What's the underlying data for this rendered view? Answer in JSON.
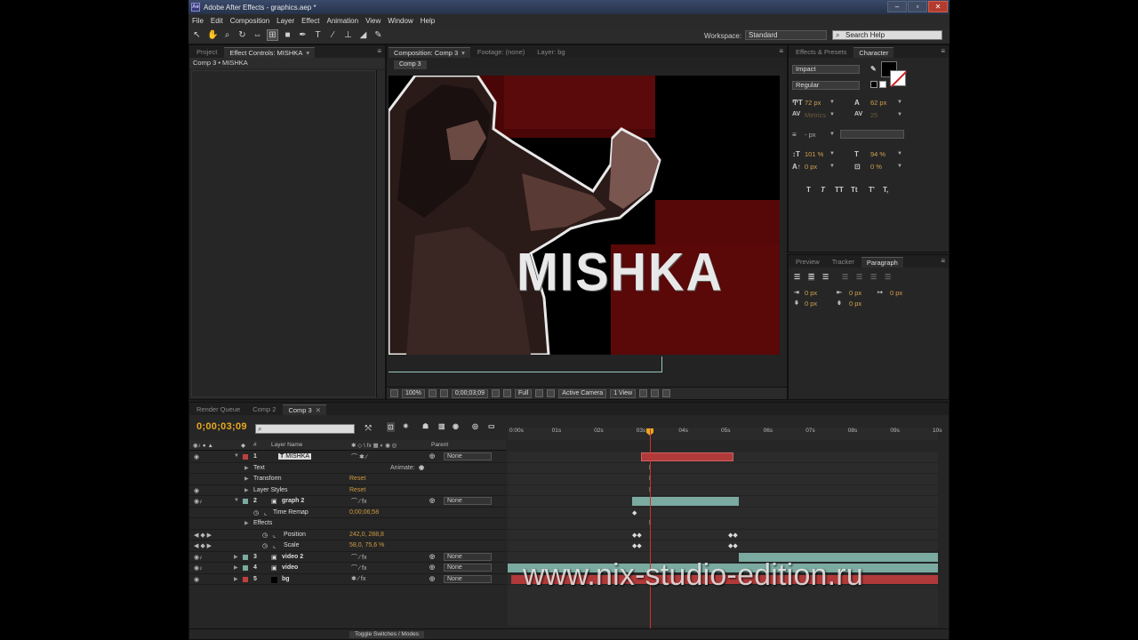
{
  "window": {
    "title": "Adobe After Effects - graphics.aep *",
    "app_icon": "Ae"
  },
  "menu": [
    "File",
    "Edit",
    "Composition",
    "Layer",
    "Effect",
    "Animation",
    "View",
    "Window",
    "Help"
  ],
  "toolbar": {
    "workspace_label": "Workspace:",
    "workspace_value": "Standard",
    "search_placeholder": "Search Help"
  },
  "left_panel": {
    "tabs": [
      "Project",
      "Effect Controls: MISHKA"
    ],
    "subtitle": "Comp 3 • MISHKA"
  },
  "comp_panel": {
    "tabs": [
      "Composition: Comp 3",
      "Footage: (none)",
      "Layer: bg"
    ],
    "sub_tab": "Comp 3",
    "canvas_text": "MISHKA",
    "bottom": {
      "zoom": "100%",
      "timecode": "0;00;03;09",
      "resolution": "Full",
      "camera": "Active Camera",
      "view": "1 View"
    }
  },
  "character_panel": {
    "tabs": [
      "Effects & Presets",
      "Character"
    ],
    "font": "Impact",
    "style": "Regular",
    "size": "72 px",
    "leading": "62 px",
    "kerning": "Metrics",
    "tracking": "25",
    "stroke_width": "- px",
    "v_scale": "101 %",
    "h_scale": "94 %",
    "baseline": "0 px",
    "tsume": "0 %",
    "type_buttons": [
      "T",
      "T",
      "TT",
      "Tt",
      "T'",
      "T,"
    ]
  },
  "paragraph_panel": {
    "tabs": [
      "Preview",
      "Tracker",
      "Paragraph"
    ],
    "fields": [
      "0 px",
      "0 px",
      "0 px",
      "0 px",
      "0 px"
    ]
  },
  "timeline": {
    "tabs": [
      "Render Queue",
      "Comp 2",
      "Comp 3"
    ],
    "timecode": "0;00;03;09",
    "columns": {
      "layer_name": "Layer Name",
      "parent": "Parent"
    },
    "ruler_ticks": [
      "0:00s",
      "01s",
      "02s",
      "03s",
      "04s",
      "05s",
      "06s",
      "07s",
      "08s",
      "09s",
      "10s"
    ],
    "rows": [
      {
        "num": "1",
        "name": "MISHKA",
        "parent": "None",
        "type": "text"
      },
      {
        "name": "Text",
        "extra": "Animate:"
      },
      {
        "name": "Transform",
        "value": "Reset"
      },
      {
        "name": "Layer Styles",
        "value": "Reset"
      },
      {
        "num": "2",
        "name": "graph 2",
        "parent": "None"
      },
      {
        "name": "Time Remap",
        "value": "0;00;06;58"
      },
      {
        "name": "Effects"
      },
      {
        "name": "Position",
        "value": "242,0, 288,8"
      },
      {
        "name": "Scale",
        "value": "58,0, 75,6 %"
      },
      {
        "num": "3",
        "name": "video 2",
        "parent": "None"
      },
      {
        "num": "4",
        "name": "video",
        "parent": "None"
      },
      {
        "num": "5",
        "name": "bg",
        "parent": "None"
      }
    ],
    "footer_toggle": "Toggle Switches / Modes"
  },
  "watermark": "www.nix-studio-edition.ru",
  "colors": {
    "timecode": "#e8a820",
    "layer_red": "#c04040",
    "layer_teal": "#7aaaa0",
    "playhead": "#d03030"
  }
}
